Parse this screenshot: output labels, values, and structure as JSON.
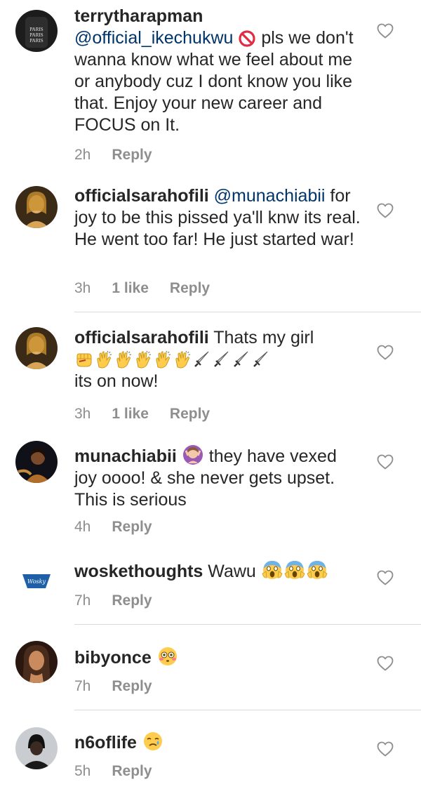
{
  "comments": [
    {
      "username": "terrytharapman",
      "mention": "@official_ikechukwu",
      "text": "pls we don't wanna know what we feel about me or anybody cuz I dont know you like that. Enjoy your new career and FOCUS on It.",
      "time": "2h",
      "reply": "Reply"
    },
    {
      "username": "officialsarahofili",
      "mention": "@munachiabii",
      "text": "for joy to be this pissed ya'll knw its real. He went too far! He just started war!",
      "time": "3h",
      "likes": "1 like",
      "reply": "Reply"
    },
    {
      "username": "officialsarahofili",
      "text_before": "Thats my girl",
      "text_after": "its on now!",
      "time": "3h",
      "likes": "1 like",
      "reply": "Reply"
    },
    {
      "username": "munachiabii",
      "text_rest": "they have",
      "text": "vexed joy oooo! & she never gets upset. This is serious",
      "time": "4h",
      "reply": "Reply"
    },
    {
      "username": "woskethoughts",
      "text": "Wawu",
      "time": "7h",
      "reply": "Reply"
    },
    {
      "username": "bibyonce",
      "time": "7h",
      "reply": "Reply"
    },
    {
      "username": "n6oflife",
      "time": "5h",
      "reply": "Reply"
    }
  ],
  "icons": {
    "heart": "heart-outline-icon",
    "prohibited": "prohibited-icon",
    "fist": "fist-emoji-icon",
    "clap": "clapping-hands-emoji-icon",
    "dagger": "dagger-emoji-icon",
    "woman_gesture": "woman-gesturing-emoji-icon",
    "scream": "screaming-face-emoji-icon",
    "flushed": "flushed-face-emoji-icon",
    "crying": "crying-face-emoji-icon"
  },
  "colors": {
    "text": "#262626",
    "meta": "#8e8e8e",
    "mention": "#003569",
    "divider": "#dbdbdb"
  }
}
